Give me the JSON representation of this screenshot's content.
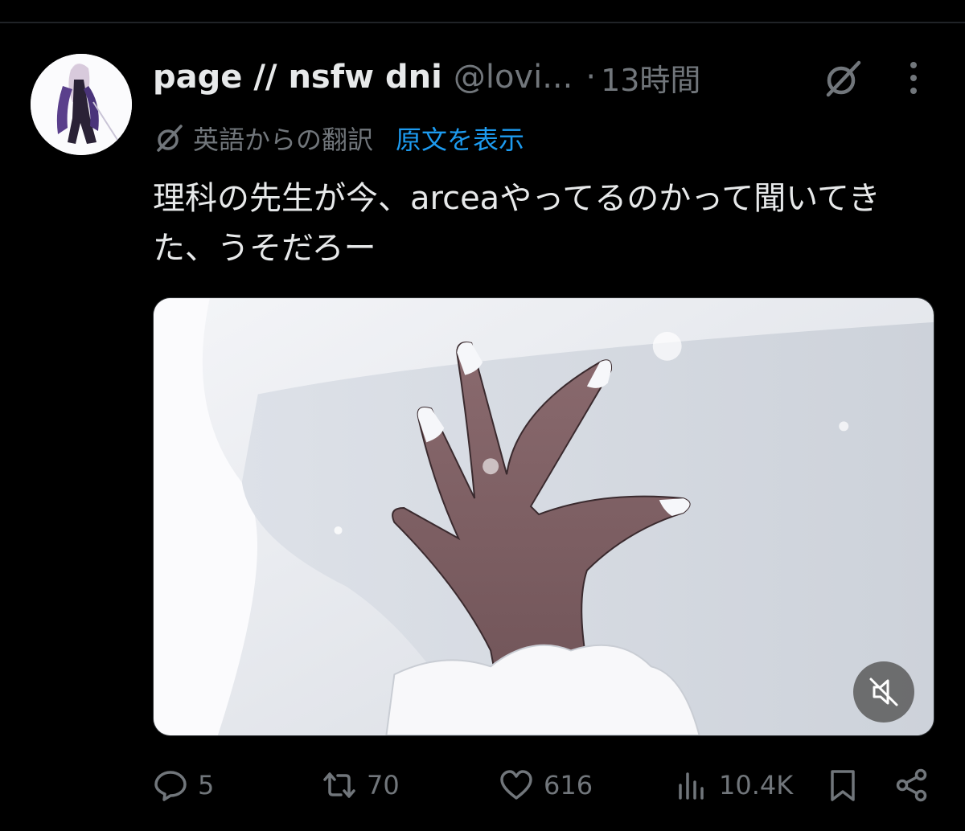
{
  "tweet": {
    "display_name": "page // nsfw dni",
    "handle": "@lovi...",
    "separator": "·",
    "time": "13時間",
    "translation_label": "英語からの翻訳",
    "show_original": "原文を表示",
    "text": "理科の先生が今、arceaやってるのかって聞いてきた、うそだろー"
  },
  "media": {
    "mute_icon": "speaker-muted-icon"
  },
  "actions": {
    "replies": "5",
    "retweets": "70",
    "likes": "616",
    "views": "10.4K"
  },
  "icons": {
    "grok": "grok-icon",
    "more": "more-dots-icon",
    "reply": "reply-icon",
    "retweet": "retweet-icon",
    "like": "heart-icon",
    "views": "views-icon",
    "bookmark": "bookmark-icon",
    "share": "share-icon"
  },
  "colors": {
    "background": "#000000",
    "text_primary": "#e7e9ea",
    "text_secondary": "#71767b",
    "link": "#1d9bf0"
  }
}
